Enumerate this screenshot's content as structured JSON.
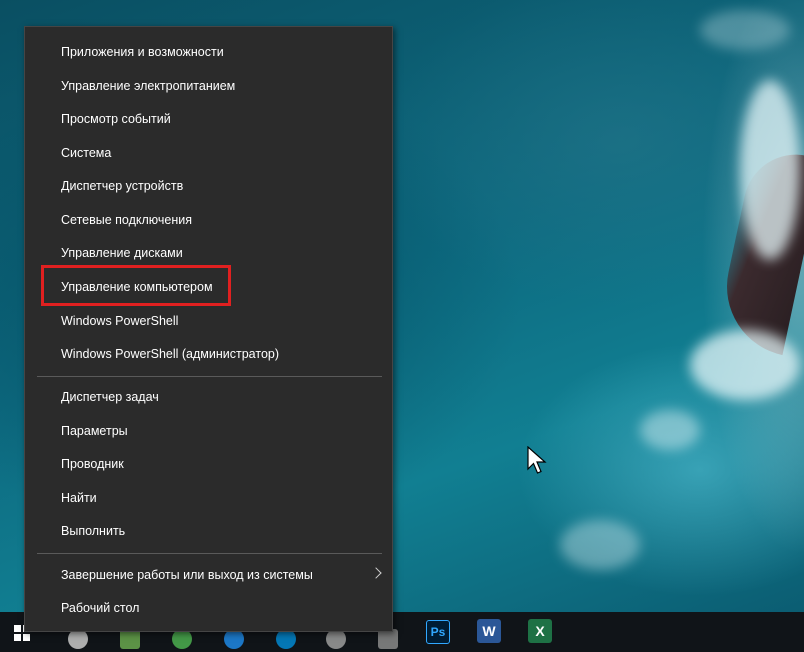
{
  "menu": {
    "items_group1": [
      {
        "label": "Приложения и возможности"
      },
      {
        "label": "Управление электропитанием"
      },
      {
        "label": "Просмотр событий"
      },
      {
        "label": "Система"
      },
      {
        "label": "Диспетчер устройств"
      },
      {
        "label": "Сетевые подключения"
      },
      {
        "label": "Управление дисками"
      },
      {
        "label": "Управление компьютером"
      },
      {
        "label": "Windows PowerShell"
      },
      {
        "label": "Windows PowerShell (администратор)"
      }
    ],
    "items_group2": [
      {
        "label": "Диспетчер задач"
      },
      {
        "label": "Параметры"
      },
      {
        "label": "Проводник"
      },
      {
        "label": "Найти"
      },
      {
        "label": "Выполнить"
      }
    ],
    "items_group3": [
      {
        "label": "Завершение работы или выход из системы",
        "has_submenu": true
      },
      {
        "label": "Рабочий стол"
      }
    ],
    "highlighted_item": "Управление компьютером",
    "highlight_color": "#e02020",
    "background_color": "#2b2b2b"
  },
  "taskbar": {
    "apps": [
      {
        "name": "start-icon"
      },
      {
        "name": "photoshop-icon",
        "label": "Ps"
      },
      {
        "name": "word-icon",
        "label": "W"
      },
      {
        "name": "excel-icon",
        "label": "X"
      }
    ],
    "background_color": "#101418"
  }
}
